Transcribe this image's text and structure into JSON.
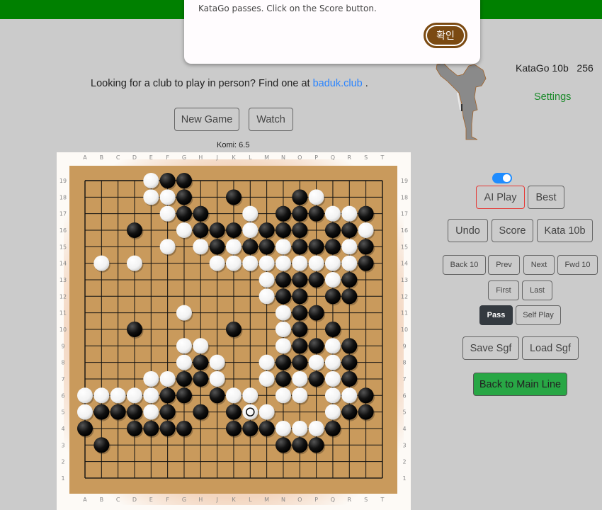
{
  "dialog": {
    "message": "KataGo passes. Click on the Score button.",
    "ok_label": "확인"
  },
  "club": {
    "text": "Looking for a club to play in person? Find one at ",
    "link_text": "baduk.club",
    "suffix": " ."
  },
  "game_buttons": {
    "new_game": "New Game",
    "watch": "Watch"
  },
  "komi_label": "Komi: 6.5",
  "engine": {
    "name": "KataGo 10b",
    "visits": "256",
    "settings": "Settings"
  },
  "controls": {
    "ai_toggle_on": true,
    "ai_play": "AI Play",
    "best": "Best",
    "undo": "Undo",
    "score": "Score",
    "kata": "Kata 10b",
    "back10": "Back 10",
    "prev": "Prev",
    "next": "Next",
    "fwd10": "Fwd 10",
    "first": "First",
    "last": "Last",
    "pass": "Pass",
    "self_play": "Self Play",
    "save_sgf": "Save Sgf",
    "load_sgf": "Load Sgf",
    "back_main": "Back to Main Line"
  },
  "colors": {
    "topbar": "#008000",
    "board": "#c99a5c",
    "accent_green": "#28a745",
    "ai_play_border": "#e53935",
    "pass_bg": "#343a40",
    "dialog_button": "#7b4a12",
    "link": "#2a84ff"
  },
  "board": {
    "size": 19,
    "columns": [
      "A",
      "B",
      "C",
      "D",
      "E",
      "F",
      "G",
      "H",
      "J",
      "K",
      "L",
      "M",
      "N",
      "O",
      "P",
      "Q",
      "R",
      "S",
      "T"
    ],
    "rows": [
      "19",
      "18",
      "17",
      "16",
      "15",
      "14",
      "13",
      "12",
      "11",
      "10",
      "9",
      "8",
      "7",
      "6",
      "5",
      "4",
      "3",
      "2",
      "1"
    ],
    "last_move": "L5",
    "black": [
      "F19",
      "G19",
      "G18",
      "K18",
      "O18",
      "G17",
      "H17",
      "N17",
      "O17",
      "P17",
      "S17",
      "D16",
      "H16",
      "J16",
      "K16",
      "M16",
      "N16",
      "O16",
      "Q16",
      "R16",
      "J15",
      "L15",
      "M15",
      "O15",
      "P15",
      "Q15",
      "S15",
      "S14",
      "N13",
      "O13",
      "P13",
      "R13",
      "N12",
      "O12",
      "Q12",
      "R12",
      "O11",
      "P11",
      "D10",
      "K10",
      "O10",
      "Q10",
      "O9",
      "P9",
      "R9",
      "H8",
      "N8",
      "O8",
      "R8",
      "G7",
      "H7",
      "N7",
      "P7",
      "R7",
      "F6",
      "G6",
      "J6",
      "S6",
      "B5",
      "C5",
      "D5",
      "F5",
      "H5",
      "K5",
      "R5",
      "S5",
      "A4",
      "D4",
      "E4",
      "F4",
      "G4",
      "K4",
      "L4",
      "M4",
      "Q4",
      "B3",
      "N3",
      "O3",
      "P3"
    ],
    "white": [
      "E19",
      "E18",
      "F18",
      "P18",
      "F17",
      "L17",
      "Q17",
      "R17",
      "G16",
      "L16",
      "S16",
      "F15",
      "H15",
      "K15",
      "N15",
      "R15",
      "B14",
      "D14",
      "J14",
      "K14",
      "L14",
      "M14",
      "N14",
      "O14",
      "P14",
      "Q14",
      "R14",
      "M13",
      "Q13",
      "M12",
      "G11",
      "N11",
      "N10",
      "G9",
      "H9",
      "N9",
      "Q9",
      "G8",
      "J8",
      "M8",
      "P8",
      "Q8",
      "E7",
      "F7",
      "J7",
      "M7",
      "O7",
      "Q7",
      "A6",
      "B6",
      "C6",
      "D6",
      "E6",
      "K6",
      "L6",
      "N6",
      "O6",
      "Q6",
      "R6",
      "A5",
      "E5",
      "L5",
      "M5",
      "Q5",
      "N4",
      "O4",
      "P4"
    ]
  }
}
